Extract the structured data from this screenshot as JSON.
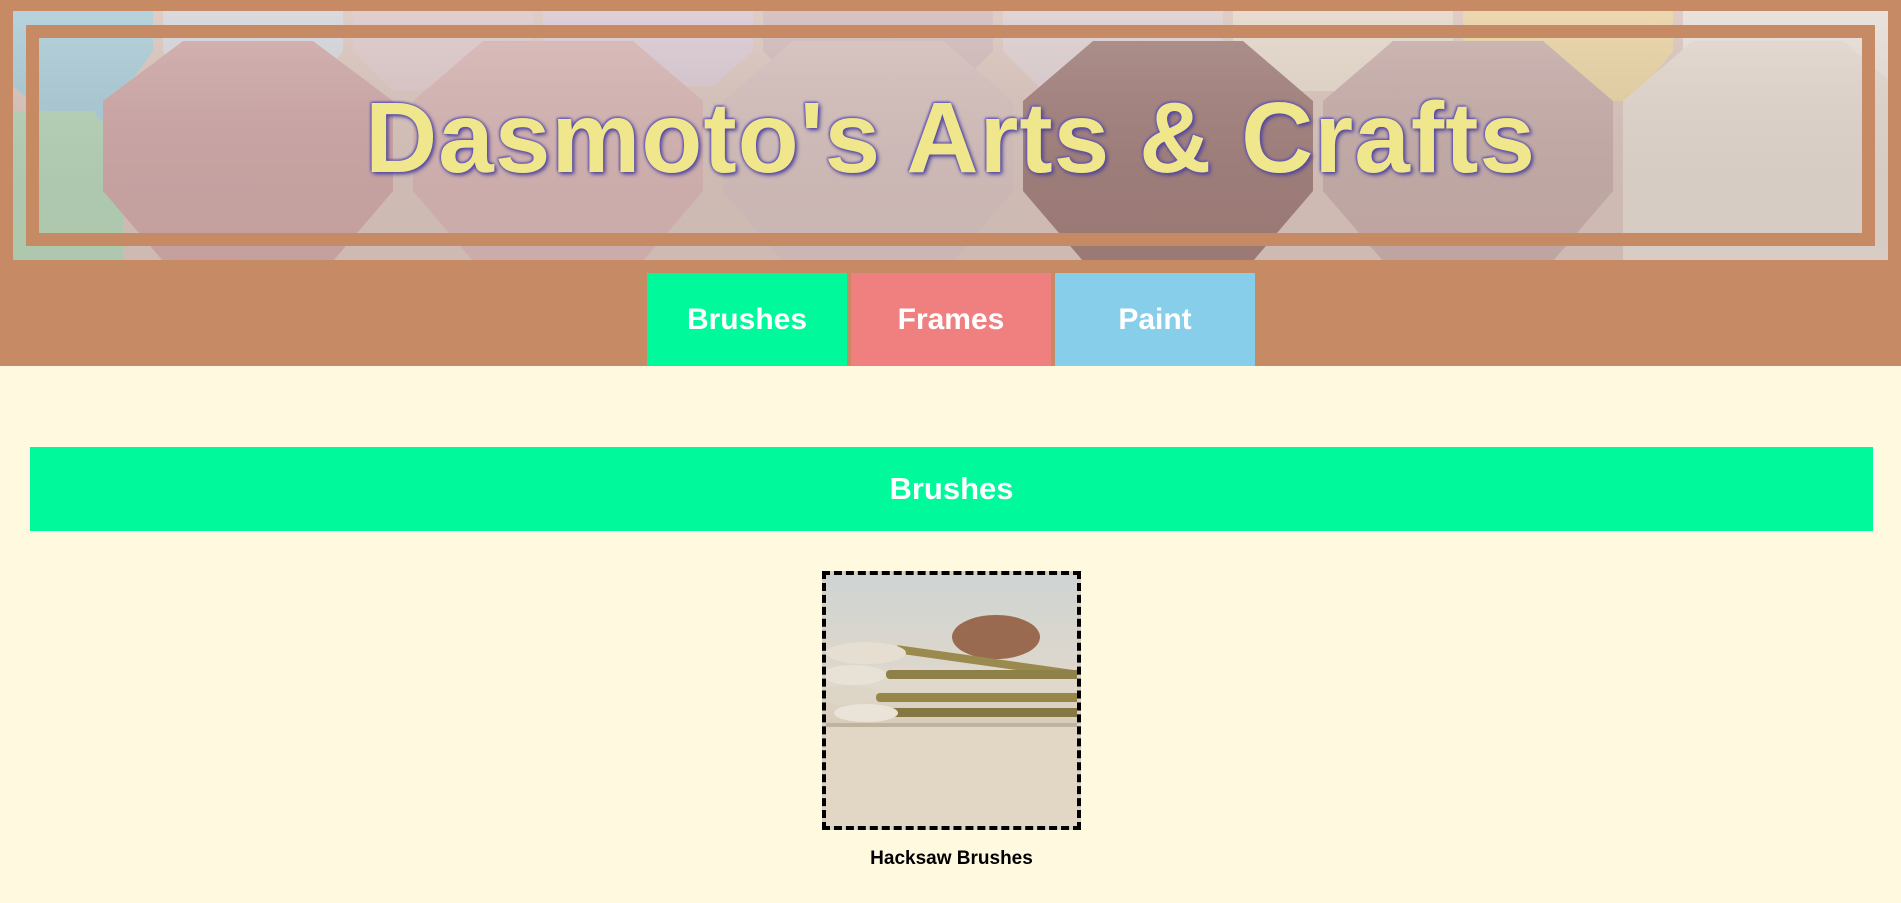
{
  "header": {
    "title": "Dasmoto's Arts & Crafts"
  },
  "nav": {
    "items": [
      {
        "label": "Brushes",
        "color": "#00f99a"
      },
      {
        "label": "Frames",
        "color": "#f08080"
      },
      {
        "label": "Paint",
        "color": "#87ceeb"
      }
    ]
  },
  "section": {
    "heading": "Brushes",
    "heading_color": "#00f99a"
  },
  "product": {
    "caption": "Hacksaw Brushes",
    "image_icon": "paint-brushes-photo"
  },
  "colors": {
    "header_bg": "#c68b65",
    "page_bg": "#fff9e0",
    "title_color": "#f0e68c"
  }
}
